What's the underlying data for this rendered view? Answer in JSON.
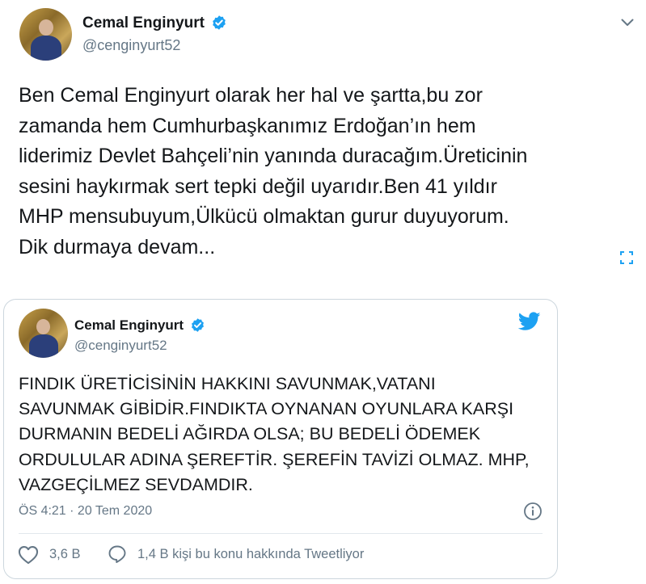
{
  "tweet": {
    "author_name": "Cemal Enginyurt",
    "author_handle": "@cenginyurt52",
    "text_lines": [
      "Ben Cemal Enginyurt olarak her hal ve şartta,bu zor",
      "zamanda hem Cumhurbaşkanımız Erdoğan’ın hem",
      "liderimiz Devlet Bahçeli’nin yanında duracağım.Üreticinin",
      "sesini haykırmak sert tepki değil uyarıdır.Ben 41 yıldır",
      "MHP mensubuyum,Ülkücü olmaktan gurur duyuyorum.",
      "Dik durmaya devam..."
    ]
  },
  "quoted_tweet": {
    "author_name": "Cemal Enginyurt",
    "author_handle": "@cenginyurt52",
    "text_lines": [
      "FINDIK ÜRETİCİSİNİN HAKKINI SAVUNMAK,VATANI",
      "SAVUNMAK GİBİDİR.FINDIKTA OYNANAN OYUNLARA KARŞI",
      "DURMANIN BEDELİ AĞIRDA OLSA; BU BEDELİ ÖDEMEK",
      "ORDULULAR ADINA ŞEREFTİR. ŞEREFİN TAVİZİ OLMAZ. MHP,",
      "VAZGEÇİLMEZ SEVDAMDIR."
    ],
    "timestamp": "ÖS 4:21 · 20 Tem 2020",
    "like_count": "3,6 B",
    "discussion_text": "1,4 B kişi bu konu hakkında Tweetliyor"
  },
  "colors": {
    "verified": "#1da1f2",
    "twitter_blue": "#1da1f2",
    "muted": "#657786",
    "border": "#ccd6dd"
  },
  "icons": {
    "verified": "verified-badge-icon",
    "menu": "chevron-down-icon",
    "expand": "expand-icon",
    "twitter": "twitter-bird-icon",
    "info": "info-icon",
    "like": "heart-icon",
    "reply": "speech-bubble-icon"
  }
}
